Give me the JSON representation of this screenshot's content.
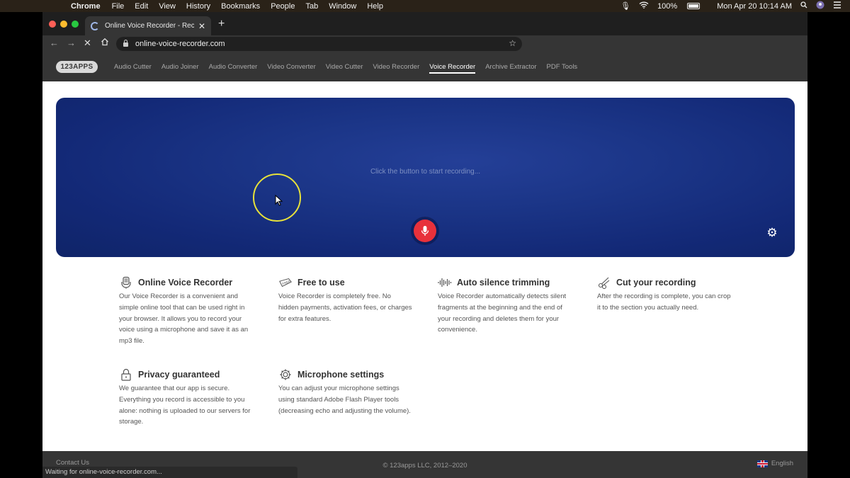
{
  "menubar": {
    "app_name": "Chrome",
    "menus": [
      "File",
      "Edit",
      "View",
      "History",
      "Bookmarks",
      "People",
      "Tab",
      "Window",
      "Help"
    ],
    "battery": "100%",
    "datetime": "Mon Apr 20  10:14 AM"
  },
  "browser": {
    "tab_title": "Online Voice Recorder - Record",
    "url": "online-voice-recorder.com"
  },
  "site": {
    "logo": "123APPS",
    "nav": [
      {
        "label": "Audio Cutter"
      },
      {
        "label": "Audio Joiner"
      },
      {
        "label": "Audio Converter"
      },
      {
        "label": "Video Converter"
      },
      {
        "label": "Video Cutter"
      },
      {
        "label": "Video Recorder"
      },
      {
        "label": "Voice Recorder",
        "active": true
      },
      {
        "label": "Archive Extractor"
      },
      {
        "label": "PDF Tools"
      }
    ]
  },
  "recorder": {
    "message": "Click the button to start recording...",
    "accent_color": "#e8313b",
    "bg_color": "#1b3587"
  },
  "features": [
    {
      "icon": "microphone-icon",
      "title": "Online Voice Recorder",
      "desc": "Our Voice Recorder is a convenient and simple online tool that can be used right in your browser. It allows you to record your voice using a microphone and save it as an mp3 file."
    },
    {
      "icon": "free-tag-icon",
      "title": "Free to use",
      "desc": "Voice Recorder is completely free. No hidden payments, activation fees, or charges for extra features."
    },
    {
      "icon": "waveform-icon",
      "title": "Auto silence trimming",
      "desc": "Voice Recorder automatically detects silent fragments at the beginning and the end of your recording and deletes them for your convenience."
    },
    {
      "icon": "scissors-icon",
      "title": "Cut your recording",
      "desc": "After the recording is complete, you can crop it to the section you actually need."
    },
    {
      "icon": "lock-icon",
      "title": "Privacy guaranteed",
      "desc": "We guarantee that our app is secure. Everything you record is accessible to you alone: nothing is uploaded to our servers for storage."
    },
    {
      "icon": "gear-icon",
      "title": "Microphone settings",
      "desc": "You can adjust your microphone settings using standard Adobe Flash Player tools (decreasing echo and adjusting the volume)."
    }
  ],
  "footer": {
    "contact": "Contact Us",
    "copyright": "© 123apps LLC, 2012–2020",
    "language": "English"
  },
  "status": "Waiting for online-voice-recorder.com..."
}
